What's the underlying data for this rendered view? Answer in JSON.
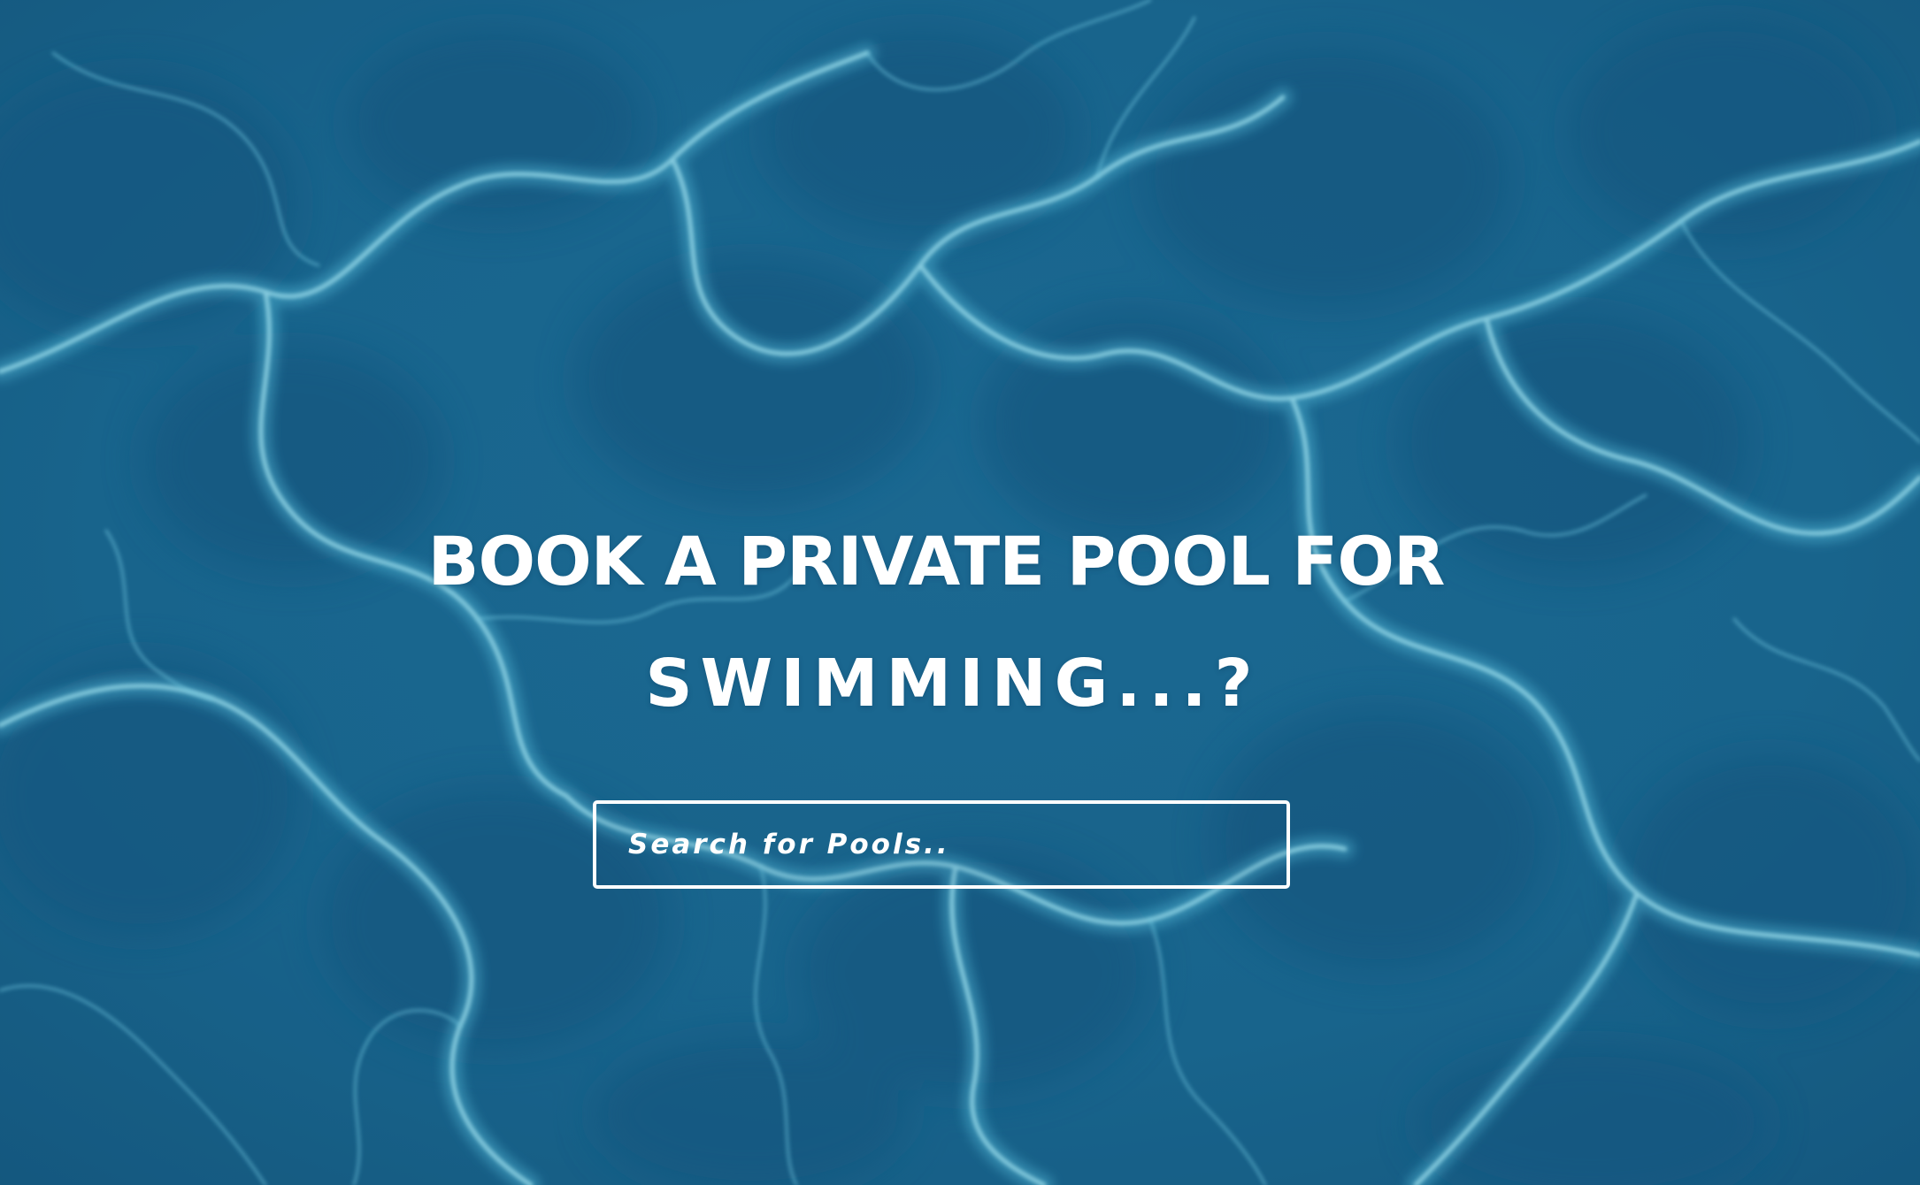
{
  "hero": {
    "headline_line1": "BOOK A PRIVATE POOL FOR",
    "headline_line2": "SWIMMING...?",
    "background": "pool-water-caustics-image",
    "colors": {
      "deep_water": "#1f6e96",
      "shadow_water": "#175b80",
      "caustic_highlight": "#8fe3f3",
      "text": "#ffffff"
    }
  },
  "search": {
    "placeholder": "Search for Pools..",
    "value": ""
  }
}
